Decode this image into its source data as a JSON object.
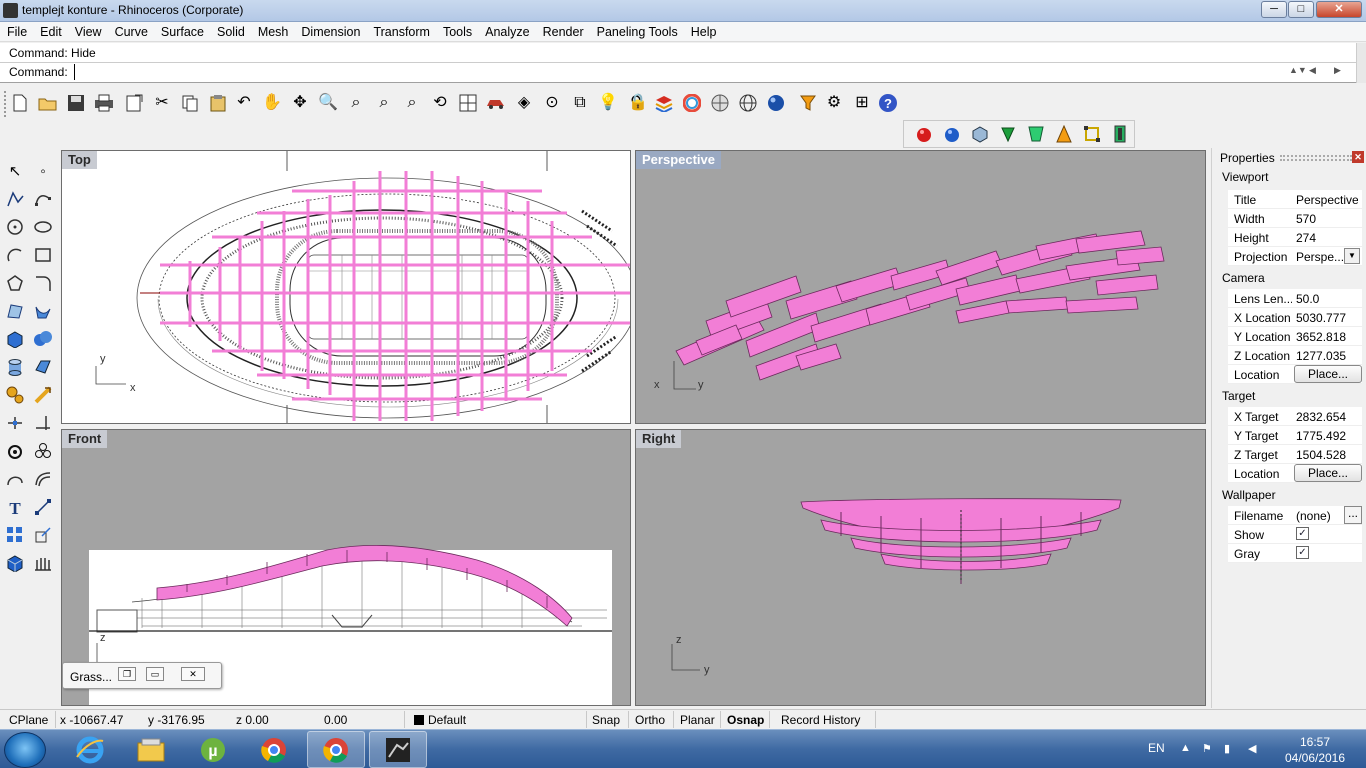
{
  "window": {
    "title": "templejt konture - Rhinoceros (Corporate)",
    "minimize": "─",
    "maximize": "□",
    "close": "✕"
  },
  "menu": [
    "File",
    "Edit",
    "View",
    "Curve",
    "Surface",
    "Solid",
    "Mesh",
    "Dimension",
    "Transform",
    "Tools",
    "Analyze",
    "Render",
    "Paneling Tools",
    "Help"
  ],
  "command": {
    "history": "Command: Hide",
    "prompt": "Command:",
    "value": ""
  },
  "viewports": {
    "top": "Top",
    "perspective": "Perspective",
    "front": "Front",
    "right": "Right"
  },
  "axes": {
    "x": "x",
    "y": "y",
    "z": "z"
  },
  "grasshopper": {
    "title": "Grass..."
  },
  "properties": {
    "title": "Properties",
    "viewport_section": "Viewport",
    "title_label": "Title",
    "title_value": "Perspective",
    "width_label": "Width",
    "width_value": "570",
    "height_label": "Height",
    "height_value": "274",
    "projection_label": "Projection",
    "projection_value": "Perspe...",
    "camera_section": "Camera",
    "lens_label": "Lens Len...",
    "lens_value": "50.0",
    "xloc_label": "X Location",
    "xloc_value": "5030.777",
    "yloc_label": "Y Location",
    "yloc_value": "3652.818",
    "zloc_label": "Z Location",
    "zloc_value": "1277.035",
    "location_label": "Location",
    "place_label": "Place...",
    "target_section": "Target",
    "xtarget_label": "X Target",
    "xtarget_value": "2832.654",
    "ytarget_label": "Y Target",
    "ytarget_value": "1775.492",
    "ztarget_label": "Z Target",
    "ztarget_value": "1504.528",
    "wallpaper_section": "Wallpaper",
    "filename_label": "Filename",
    "filename_value": "(none)",
    "browse_label": "...",
    "show_label": "Show",
    "gray_label": "Gray",
    "show_checked": "✓",
    "gray_checked": "✓"
  },
  "status": {
    "cplane": "CPlane",
    "x": "x -10667.47",
    "y": "y -3176.95",
    "z": "z 0.00",
    "extra": "0.00",
    "layer": "Default",
    "snap": "Snap",
    "ortho": "Ortho",
    "planar": "Planar",
    "osnap": "Osnap",
    "record_history": "Record History"
  },
  "taskbar": {
    "language": "EN",
    "time": "16:57",
    "date": "04/06/2016"
  },
  "colors": {
    "model_pink": "#f27ed6",
    "viewport_gray": "#a3a3a3",
    "active_title": "#9aa9c2"
  }
}
